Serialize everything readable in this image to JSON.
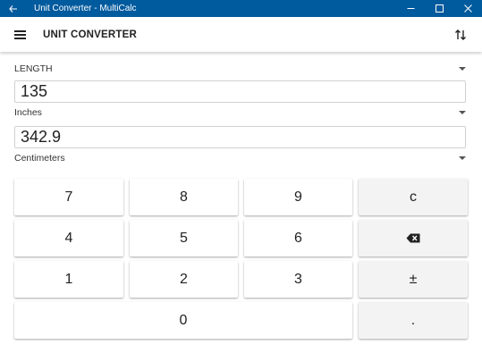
{
  "window": {
    "title": "Unit Converter - MultiCalc"
  },
  "appbar": {
    "title": "UNIT CONVERTER"
  },
  "converter": {
    "category": "LENGTH",
    "from_value": "135",
    "from_unit": "Inches",
    "to_value": "342.9",
    "to_unit": "Centimeters"
  },
  "keypad": {
    "k7": "7",
    "k8": "8",
    "k9": "9",
    "clear": "c",
    "k4": "4",
    "k5": "5",
    "k6": "6",
    "k1": "1",
    "k2": "2",
    "k3": "3",
    "sign": "±",
    "k0": "0",
    "decimal": "."
  },
  "colors": {
    "titlebar": "#005a9e",
    "op_key": "#f3f3f3"
  }
}
